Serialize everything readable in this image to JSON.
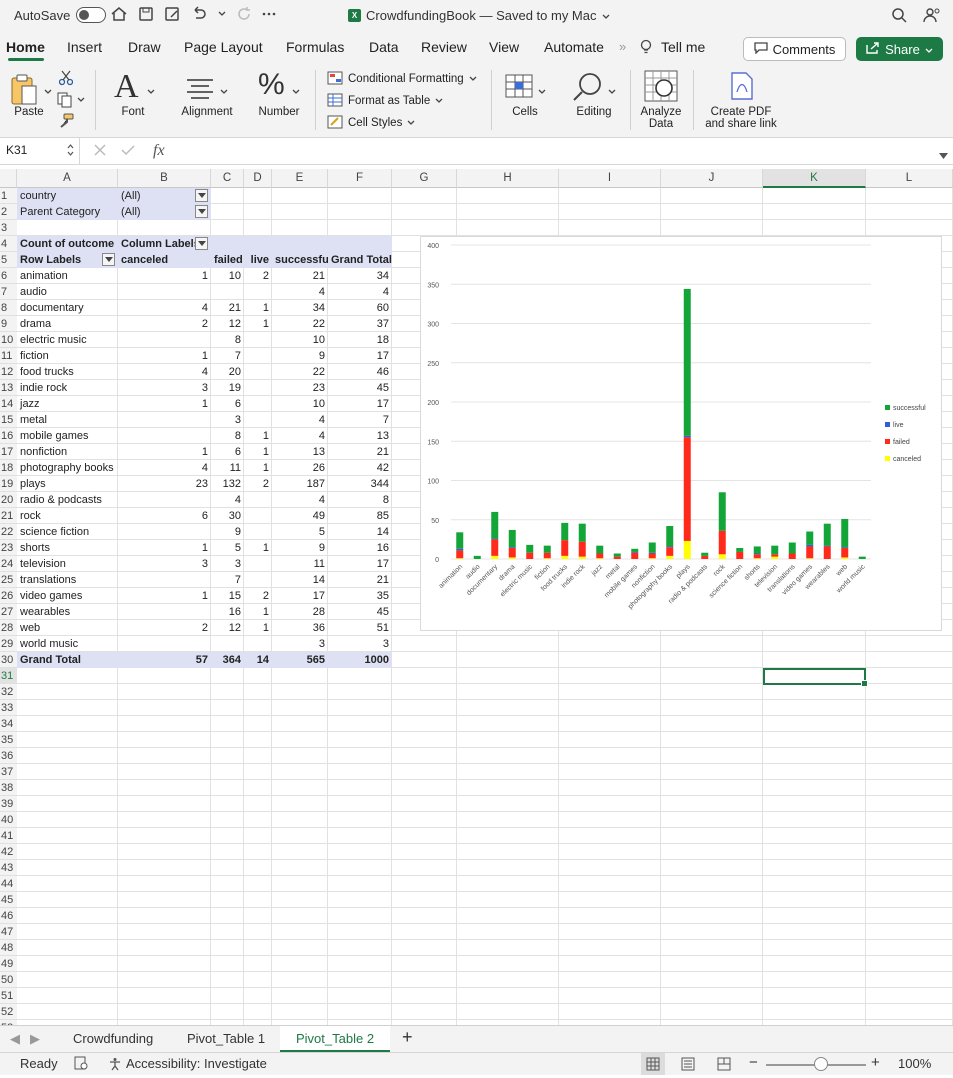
{
  "titlebar": {
    "autosave_label": "AutoSave",
    "doc_title": "CrowdfundingBook — Saved to my Mac",
    "icons": [
      "home-icon",
      "save-icon",
      "save-as-icon",
      "undo-icon",
      "redo-icon",
      "more-icon",
      "search-icon",
      "share-person-icon"
    ]
  },
  "ribbon_tabs": [
    "Home",
    "Insert",
    "Draw",
    "Page Layout",
    "Formulas",
    "Data",
    "Review",
    "View",
    "Automate"
  ],
  "ribbon_tell_me": "Tell me",
  "comments_label": "Comments",
  "share_label": "Share",
  "ribbon": {
    "paste": "Paste",
    "font": "Font",
    "alignment": "Alignment",
    "number": "Number",
    "conditional_formatting": "Conditional Formatting",
    "format_as_table": "Format as Table",
    "cell_styles": "Cell Styles",
    "cells": "Cells",
    "editing": "Editing",
    "analyze_data_1": "Analyze",
    "analyze_data_2": "Data",
    "create_pdf_1": "Create PDF",
    "create_pdf_2": "and share link"
  },
  "formula_bar": {
    "name_box": "K31",
    "fx": "fx",
    "value": ""
  },
  "columns": [
    "A",
    "B",
    "C",
    "D",
    "E",
    "F",
    "G",
    "H",
    "I",
    "J",
    "K",
    "L"
  ],
  "selected_column": "K",
  "selected_row": "31",
  "pivot": {
    "filter1_label": "country",
    "filter1_value": "(All)",
    "filter2_label": "Parent Category",
    "filter2_value": "(All)",
    "count_label": "Count of outcome",
    "col_labels": "Column Labels",
    "row_labels": "Row Labels",
    "headers": [
      "canceled",
      "failed",
      "live",
      "successful",
      "Grand Total"
    ],
    "rows": [
      {
        "name": "animation",
        "c": "1",
        "f": "10",
        "l": "2",
        "s": "21",
        "t": "34"
      },
      {
        "name": "audio",
        "c": "",
        "f": "",
        "l": "",
        "s": "4",
        "t": "4"
      },
      {
        "name": "documentary",
        "c": "4",
        "f": "21",
        "l": "1",
        "s": "34",
        "t": "60"
      },
      {
        "name": "drama",
        "c": "2",
        "f": "12",
        "l": "1",
        "s": "22",
        "t": "37"
      },
      {
        "name": "electric music",
        "c": "",
        "f": "8",
        "l": "",
        "s": "10",
        "t": "18"
      },
      {
        "name": "fiction",
        "c": "1",
        "f": "7",
        "l": "",
        "s": "9",
        "t": "17"
      },
      {
        "name": "food trucks",
        "c": "4",
        "f": "20",
        "l": "",
        "s": "22",
        "t": "46"
      },
      {
        "name": "indie rock",
        "c": "3",
        "f": "19",
        "l": "",
        "s": "23",
        "t": "45"
      },
      {
        "name": "jazz",
        "c": "1",
        "f": "6",
        "l": "",
        "s": "10",
        "t": "17"
      },
      {
        "name": "metal",
        "c": "",
        "f": "3",
        "l": "",
        "s": "4",
        "t": "7"
      },
      {
        "name": "mobile games",
        "c": "",
        "f": "8",
        "l": "1",
        "s": "4",
        "t": "13"
      },
      {
        "name": "nonfiction",
        "c": "1",
        "f": "6",
        "l": "1",
        "s": "13",
        "t": "21"
      },
      {
        "name": "photography books",
        "c": "4",
        "f": "11",
        "l": "1",
        "s": "26",
        "t": "42"
      },
      {
        "name": "plays",
        "c": "23",
        "f": "132",
        "l": "2",
        "s": "187",
        "t": "344"
      },
      {
        "name": "radio & podcasts",
        "c": "",
        "f": "4",
        "l": "",
        "s": "4",
        "t": "8"
      },
      {
        "name": "rock",
        "c": "6",
        "f": "30",
        "l": "",
        "s": "49",
        "t": "85"
      },
      {
        "name": "science fiction",
        "c": "",
        "f": "9",
        "l": "",
        "s": "5",
        "t": "14"
      },
      {
        "name": "shorts",
        "c": "1",
        "f": "5",
        "l": "1",
        "s": "9",
        "t": "16"
      },
      {
        "name": "television",
        "c": "3",
        "f": "3",
        "l": "",
        "s": "11",
        "t": "17"
      },
      {
        "name": "translations",
        "c": "",
        "f": "7",
        "l": "",
        "s": "14",
        "t": "21"
      },
      {
        "name": "video games",
        "c": "1",
        "f": "15",
        "l": "2",
        "s": "17",
        "t": "35"
      },
      {
        "name": "wearables",
        "c": "",
        "f": "16",
        "l": "1",
        "s": "28",
        "t": "45"
      },
      {
        "name": "web",
        "c": "2",
        "f": "12",
        "l": "1",
        "s": "36",
        "t": "51"
      },
      {
        "name": "world music",
        "c": "",
        "f": "",
        "l": "",
        "s": "3",
        "t": "3"
      }
    ],
    "grand_total": {
      "name": "Grand Total",
      "c": "57",
      "f": "364",
      "l": "14",
      "s": "565",
      "t": "1000"
    }
  },
  "chart_data": {
    "type": "bar",
    "stacked": true,
    "categories": [
      "animation",
      "audio",
      "documentary",
      "drama",
      "electric music",
      "fiction",
      "food trucks",
      "indie rock",
      "jazz",
      "metal",
      "mobile games",
      "nonfiction",
      "photography books",
      "plays",
      "radio & podcasts",
      "rock",
      "science fiction",
      "shorts",
      "television",
      "translations",
      "video games",
      "wearables",
      "web",
      "world music"
    ],
    "series": [
      {
        "name": "canceled",
        "color": "#ffff00",
        "values": [
          1,
          0,
          4,
          2,
          0,
          1,
          4,
          3,
          1,
          0,
          0,
          1,
          4,
          23,
          0,
          6,
          0,
          1,
          3,
          0,
          1,
          0,
          2,
          0
        ]
      },
      {
        "name": "failed",
        "color": "#ff2a1a",
        "values": [
          10,
          0,
          21,
          12,
          8,
          7,
          20,
          19,
          6,
          3,
          8,
          6,
          11,
          132,
          4,
          30,
          9,
          5,
          3,
          7,
          15,
          16,
          12,
          0
        ]
      },
      {
        "name": "live",
        "color": "#2e5fd6",
        "values": [
          2,
          0,
          1,
          1,
          0,
          0,
          0,
          0,
          0,
          0,
          1,
          1,
          1,
          2,
          0,
          0,
          0,
          1,
          0,
          0,
          2,
          1,
          1,
          0
        ]
      },
      {
        "name": "successful",
        "color": "#13a538",
        "values": [
          21,
          4,
          34,
          22,
          10,
          9,
          22,
          23,
          10,
          4,
          4,
          13,
          26,
          187,
          4,
          49,
          5,
          9,
          11,
          14,
          17,
          28,
          36,
          3
        ]
      }
    ],
    "ylim": [
      0,
      400
    ],
    "yticks": [
      0,
      50,
      100,
      150,
      200,
      250,
      300,
      350,
      400
    ],
    "legend_order": [
      "successful",
      "live",
      "failed",
      "canceled"
    ],
    "legend_position": "right"
  },
  "sheet_tabs": [
    "Crowdfunding",
    "Pivot_Table 1",
    "Pivot_Table 2"
  ],
  "active_sheet": "Pivot_Table 2",
  "status": {
    "ready": "Ready",
    "accessibility": "Accessibility: Investigate",
    "zoom": "100%",
    "zoom_fraction": 0.55
  }
}
